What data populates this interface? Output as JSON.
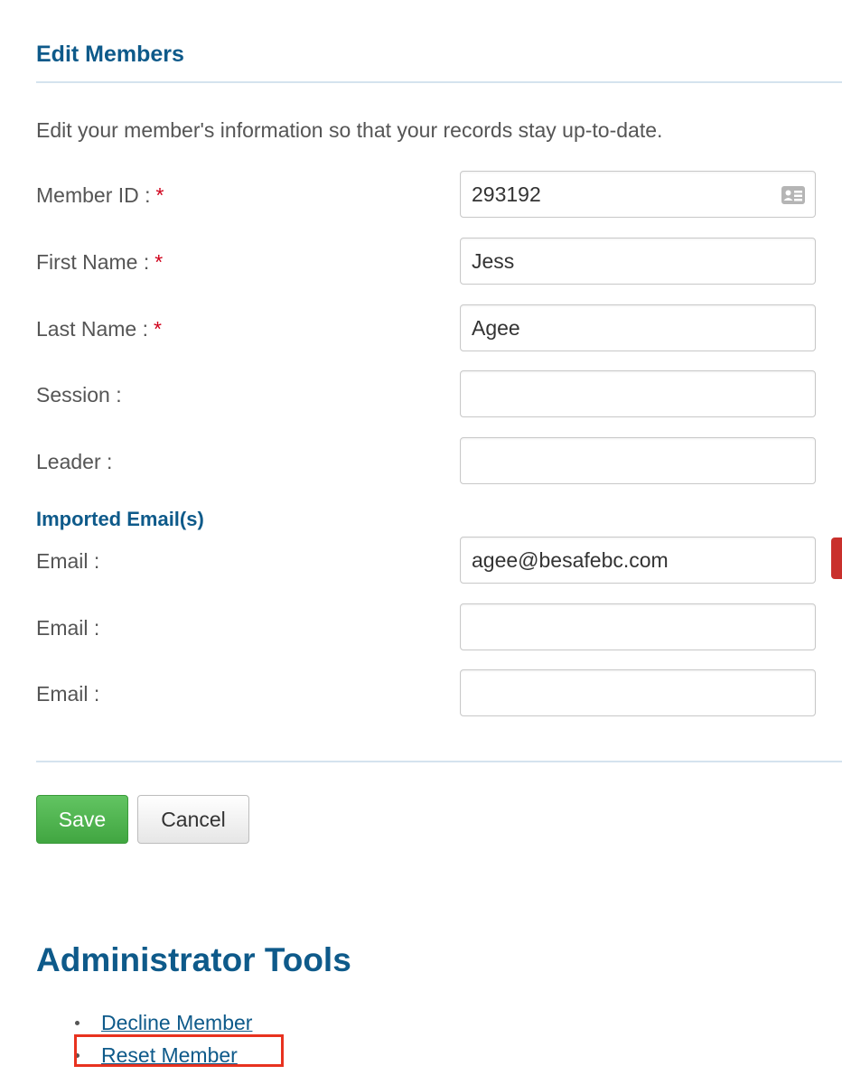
{
  "header": {
    "title": "Edit Members",
    "intro": "Edit your member's information so that your records stay up-to-date."
  },
  "form": {
    "member_id": {
      "label": "Member ID :",
      "required_mark": "*",
      "value": "293192",
      "icon": "id-card-icon"
    },
    "first_name": {
      "label": "First Name :",
      "required_mark": "*",
      "value": "Jess"
    },
    "last_name": {
      "label": "Last Name :",
      "required_mark": "*",
      "value": "Agee"
    },
    "session": {
      "label": "Session :",
      "value": ""
    },
    "leader": {
      "label": "Leader :",
      "value": ""
    }
  },
  "emails": {
    "heading": "Imported Email(s)",
    "items": [
      {
        "label": "Email :",
        "value": "agee@besafebc.com"
      },
      {
        "label": "Email :",
        "value": ""
      },
      {
        "label": "Email :",
        "value": ""
      }
    ]
  },
  "actions": {
    "save_label": "Save",
    "cancel_label": "Cancel"
  },
  "admin": {
    "title": "Administrator Tools",
    "links": [
      {
        "label": "Decline Member"
      },
      {
        "label": "Reset Member"
      }
    ]
  },
  "colors": {
    "heading": "#0e5a8a",
    "required": "#d0021b",
    "save_button": "#4cae4c",
    "danger_tab": "#c9302c",
    "highlight": "#e8321f"
  }
}
